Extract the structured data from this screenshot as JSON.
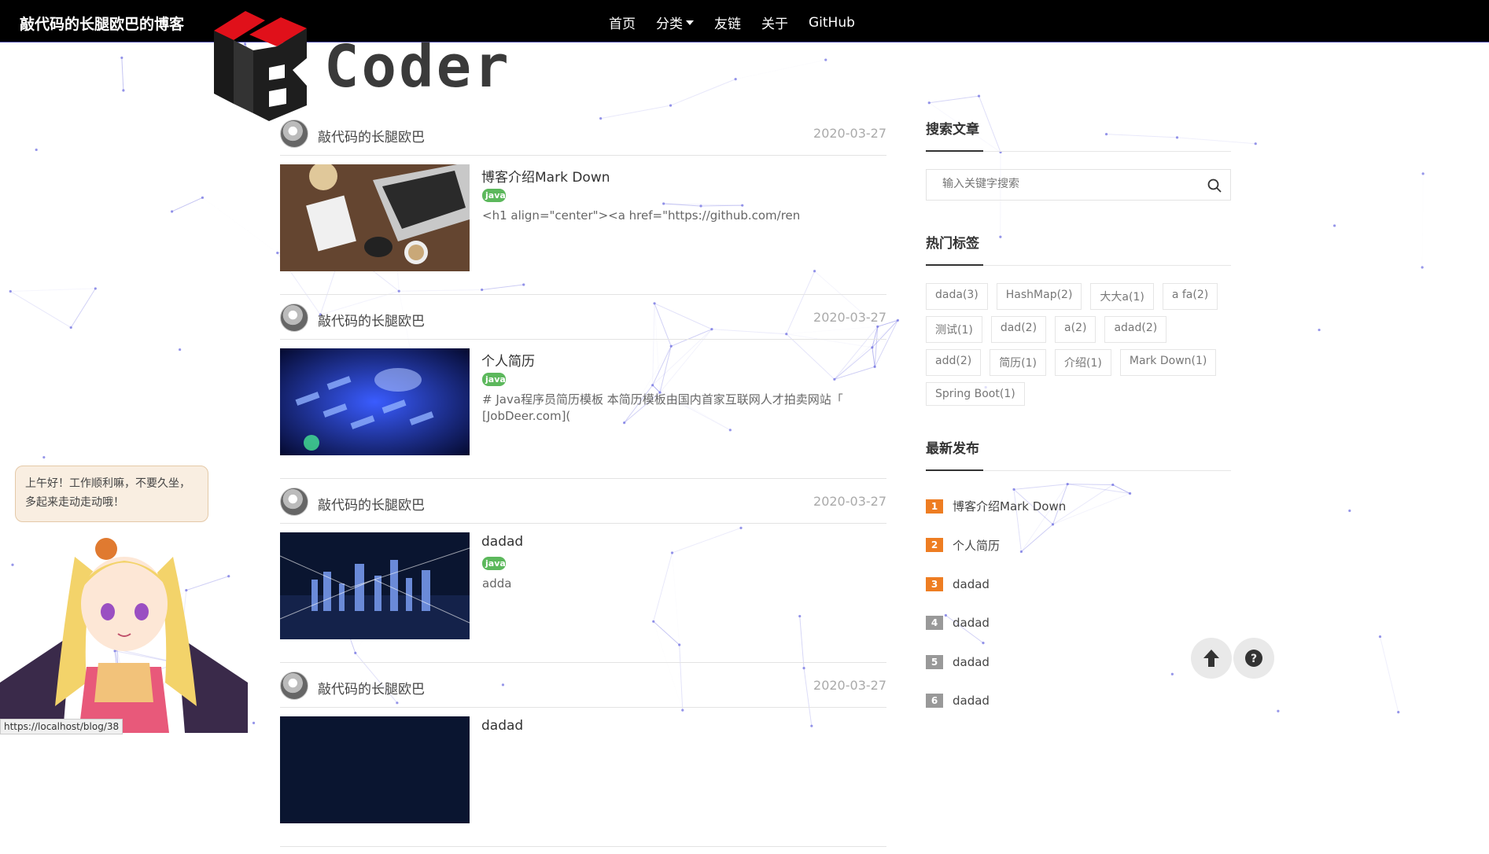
{
  "header": {
    "brand": "敲代码的长腿欧巴的博客",
    "nav": [
      {
        "label": "首页"
      },
      {
        "label": "分类",
        "has_dropdown": true
      },
      {
        "label": "友链"
      },
      {
        "label": "关于"
      },
      {
        "label": "GitHub"
      }
    ],
    "logo_text": "Coder"
  },
  "posts": [
    {
      "author": "敲代码的长腿欧巴",
      "date": "2020-03-27",
      "title": "博客介绍Mark Down",
      "tag": "java",
      "summary": "<h1 align=\"center\"><a href=\"https://github.com/ren"
    },
    {
      "author": "敲代码的长腿欧巴",
      "date": "2020-03-27",
      "title": "个人简历",
      "tag": "java",
      "summary": "# Java程序员简历模板 本简历模板由国内首家互联网人才拍卖网站「 [JobDeer.com]("
    },
    {
      "author": "敲代码的长腿欧巴",
      "date": "2020-03-27",
      "title": "dadad",
      "tag": "java",
      "summary": "adda"
    },
    {
      "author": "敲代码的长腿欧巴",
      "date": "2020-03-27",
      "title": "dadad",
      "tag": "",
      "summary": ""
    }
  ],
  "sidebar": {
    "search": {
      "title": "搜索文章",
      "placeholder": "输入关键字搜索"
    },
    "tags": {
      "title": "热门标签",
      "items": [
        "dada(3)",
        "HashMap(2)",
        "大大a(1)",
        "a fa(2)",
        "测试(1)",
        "dad(2)",
        "a(2)",
        "adad(2)",
        "add(2)",
        "简历(1)",
        "介绍(1)",
        "Mark Down(1)",
        "Spring Boot(1)"
      ]
    },
    "recent": {
      "title": "最新发布",
      "items": [
        {
          "num": "1",
          "title": "博客介绍Mark Down"
        },
        {
          "num": "2",
          "title": "个人简历"
        },
        {
          "num": "3",
          "title": "dadad"
        },
        {
          "num": "4",
          "title": "dadad"
        },
        {
          "num": "5",
          "title": "dadad"
        },
        {
          "num": "6",
          "title": "dadad"
        }
      ],
      "top_color": "#ee7d22",
      "other_color": "#999999"
    }
  },
  "mascot": {
    "greeting": "上午好！工作顺利嘛，不要久坐，多起来走动走动哦！"
  },
  "status_bar": {
    "url": "https://localhost/blog/38"
  },
  "float_buttons": [
    {
      "icon": "arrow-up-icon"
    },
    {
      "icon": "question-circle-icon"
    }
  ]
}
